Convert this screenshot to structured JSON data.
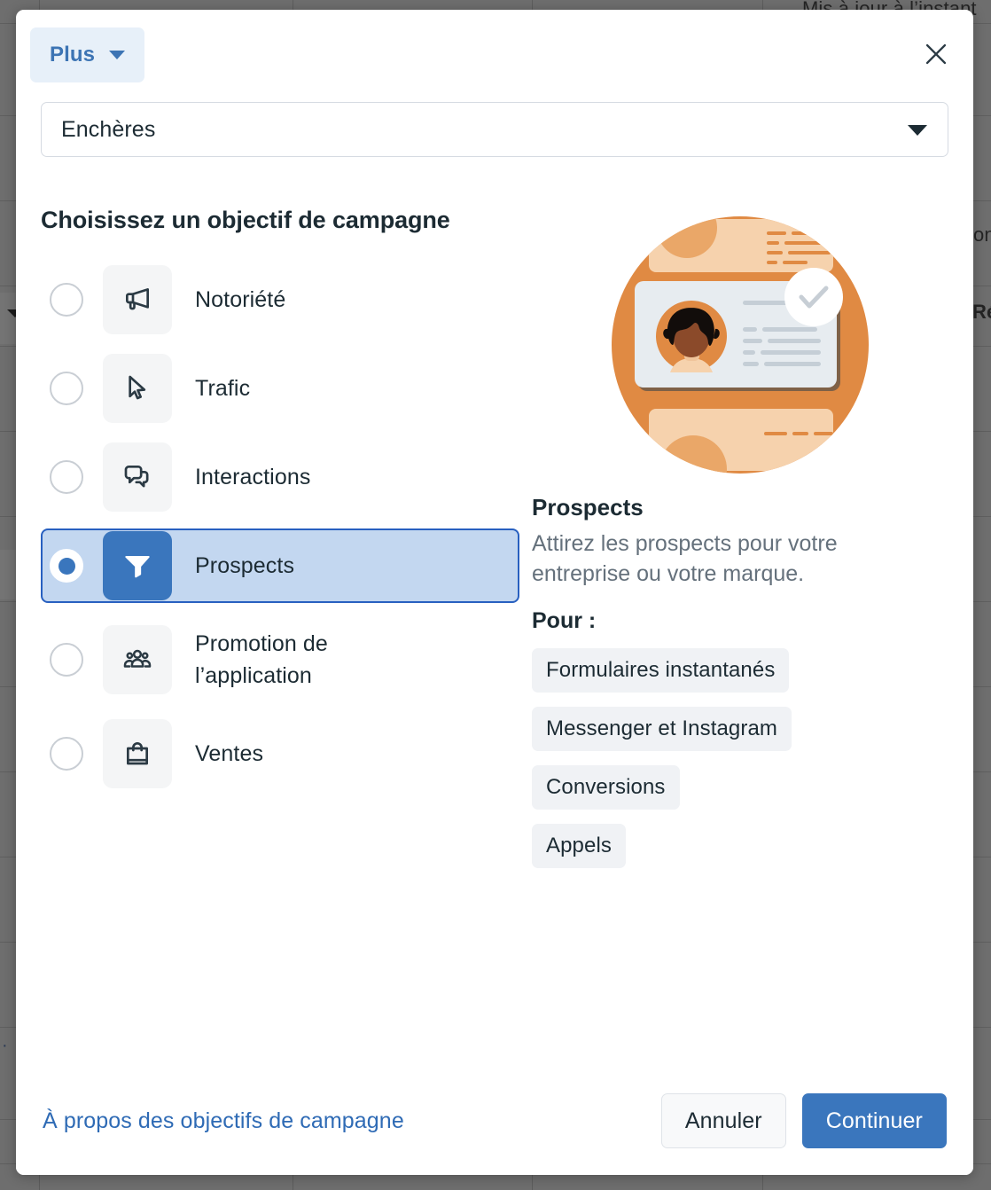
{
  "background": {
    "status_text": "Mis à jour à l’instant",
    "fragment_right_1": "on",
    "fragment_right_2": "Ré"
  },
  "modal": {
    "header": {
      "plus_button_label": "Plus",
      "plus_caret_icon": "chevron-down-icon",
      "close_icon": "close-icon"
    },
    "select": {
      "value": "Enchères",
      "caret_icon": "chevron-down-icon"
    },
    "section_title": "Choisissez un objectif de campagne",
    "options": [
      {
        "label": "Notoriété",
        "icon": "megaphone-icon",
        "selected": false
      },
      {
        "label": "Trafic",
        "icon": "cursor-arrow-icon",
        "selected": false
      },
      {
        "label": "Interactions",
        "icon": "chat-bubbles-icon",
        "selected": false
      },
      {
        "label": "Prospects",
        "icon": "funnel-icon",
        "selected": true
      },
      {
        "label": "Promotion de l’application",
        "icon": "people-group-icon",
        "selected": false
      },
      {
        "label": "Ventes",
        "icon": "shopping-bag-icon",
        "selected": false
      }
    ],
    "detail": {
      "illustration_icon": "lead-form-profile-card-illustration",
      "check_badge_icon": "check-circle-icon",
      "title": "Prospects",
      "description": "Attirez les prospects pour votre entreprise ou votre marque.",
      "for_label": "Pour :",
      "chips": [
        "Formulaires instantanés",
        "Messenger et Instagram",
        "Conversions",
        "Appels"
      ]
    },
    "footer": {
      "link": "À propos des objectifs de campagne",
      "cancel_label": "Annuler",
      "continue_label": "Continuer"
    }
  },
  "colors": {
    "accent_blue": "#3a76bd",
    "selected_row_bg": "#c3d7f0",
    "selected_row_border": "#2860c0",
    "link_blue": "#2f6bb5",
    "chip_bg": "#f0f2f5",
    "illustration_orange": "#e08a43"
  }
}
